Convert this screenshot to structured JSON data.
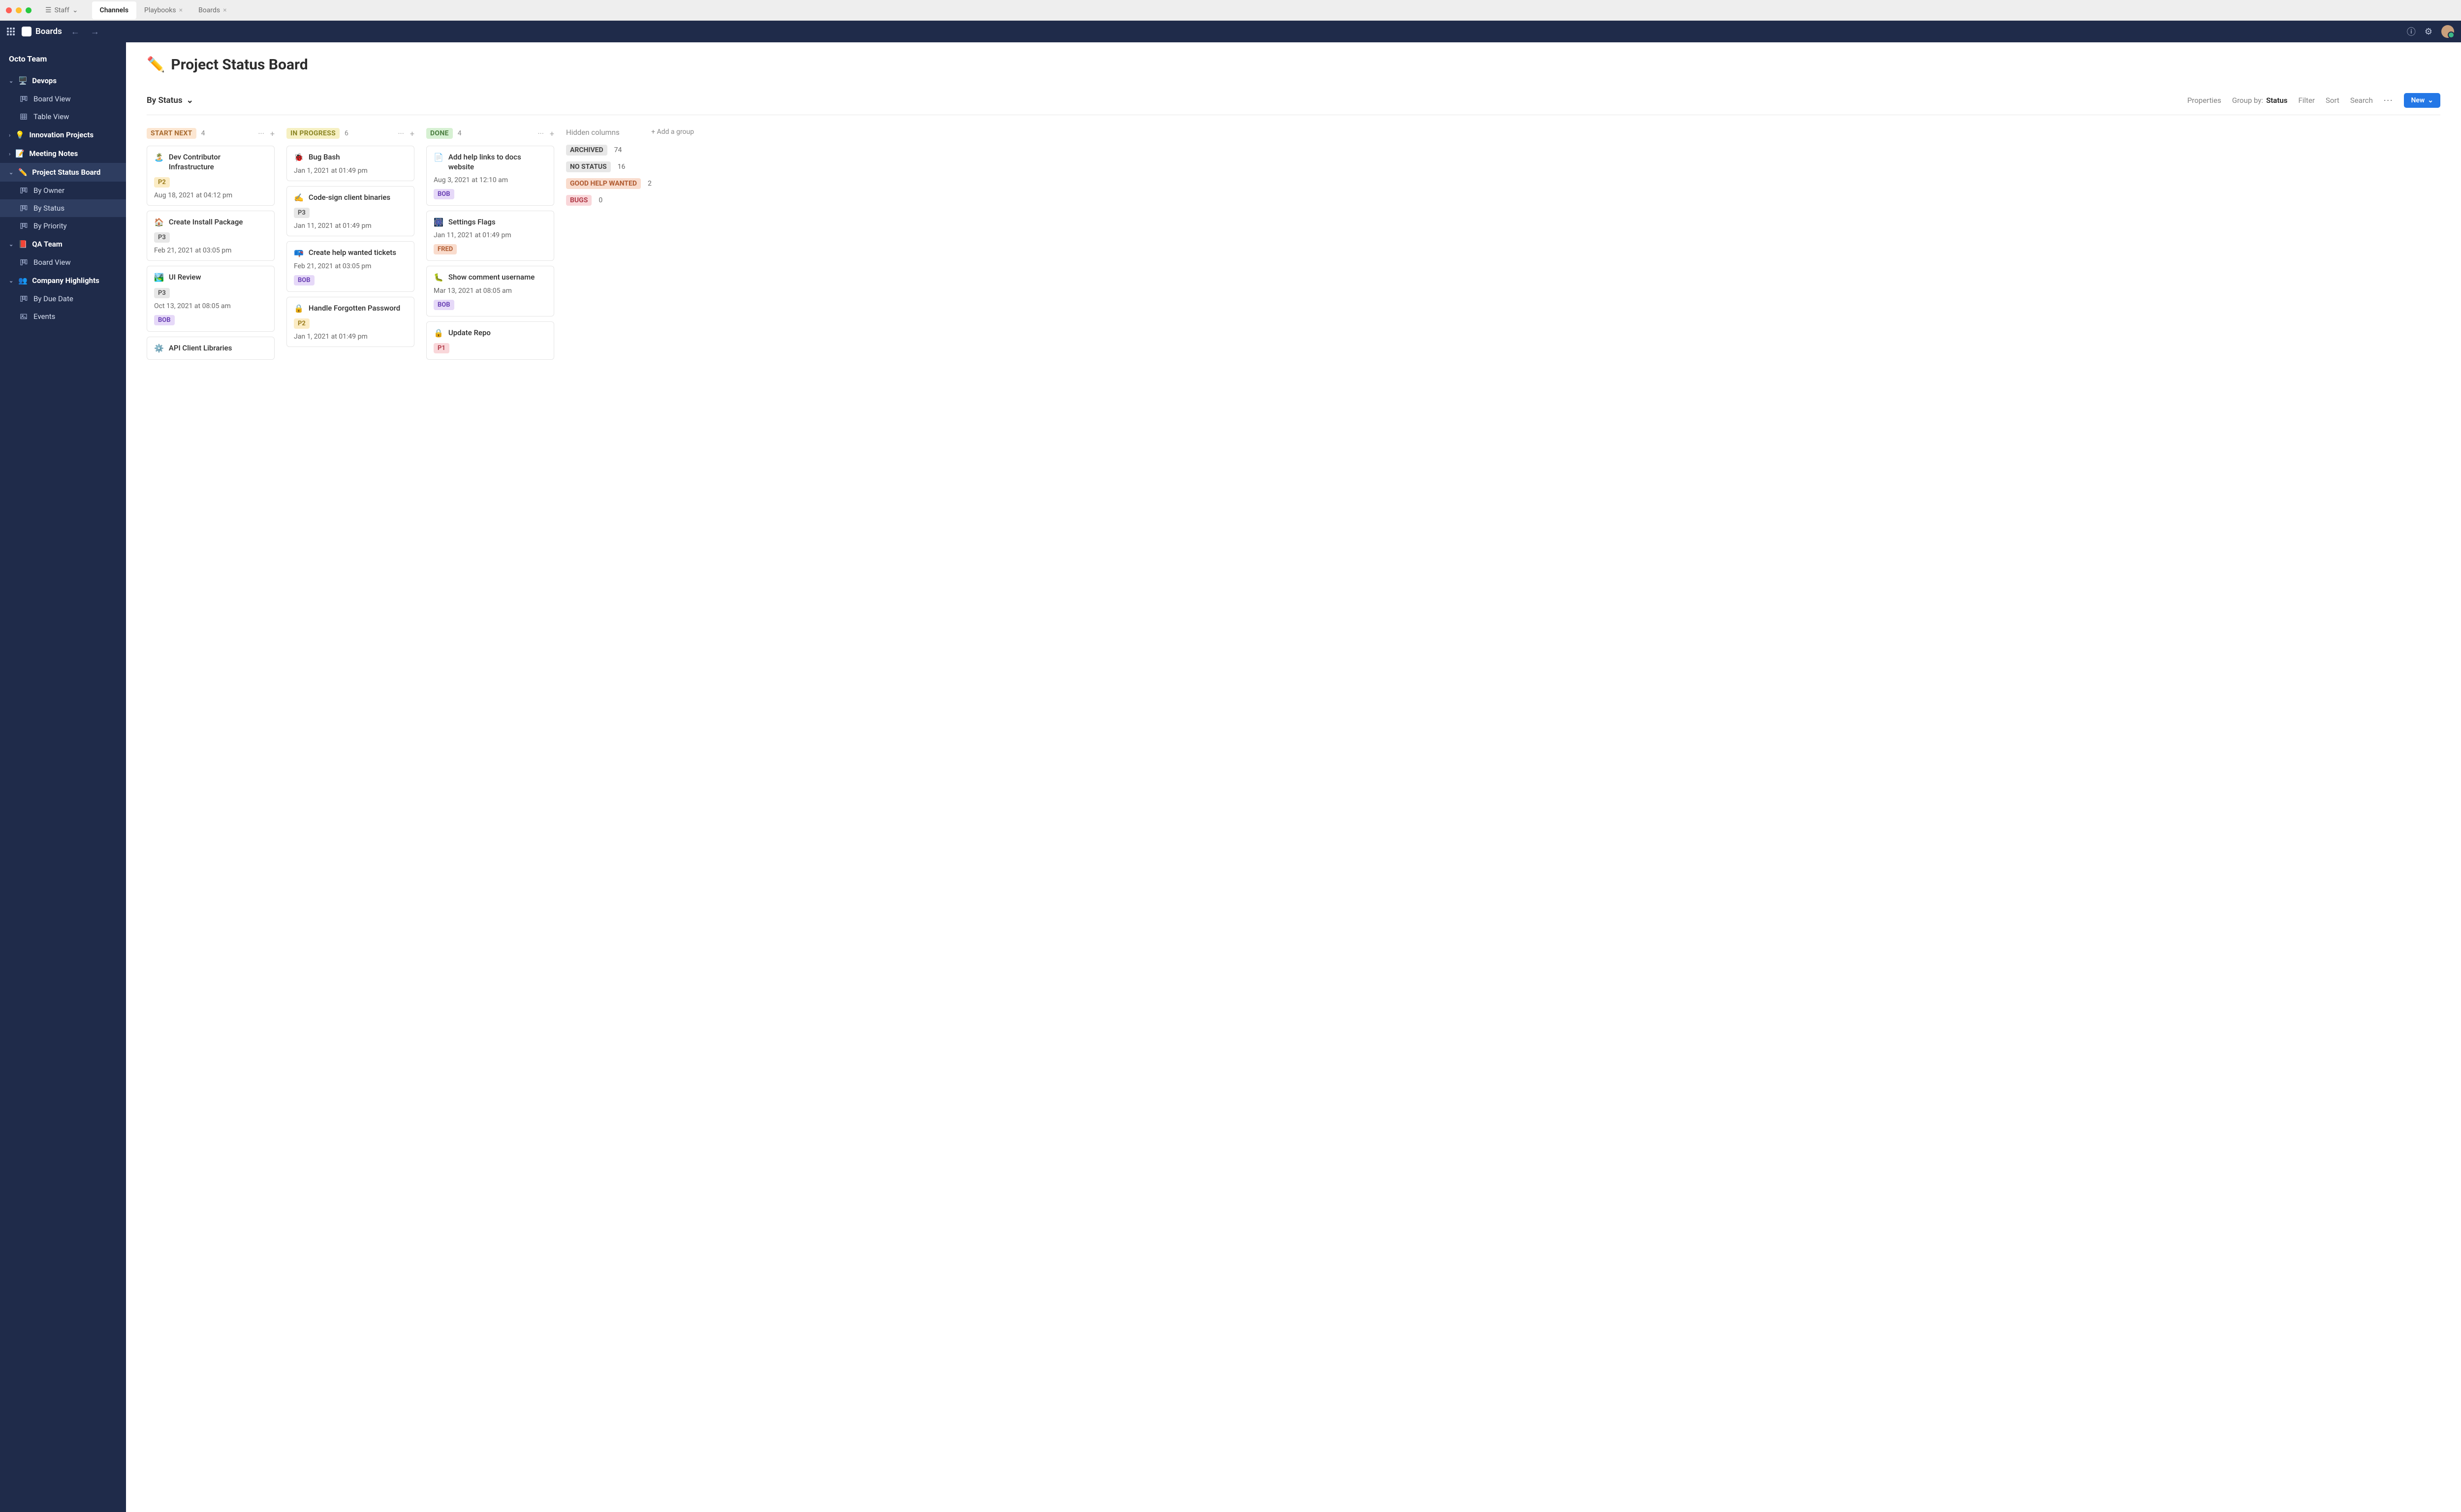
{
  "chrome": {
    "staff_label": "Staff",
    "tabs": [
      {
        "label": "Channels",
        "active": true,
        "closable": false
      },
      {
        "label": "Playbooks",
        "active": false,
        "closable": true
      },
      {
        "label": "Boards",
        "active": false,
        "closable": true
      }
    ]
  },
  "nav": {
    "brand": "Boards"
  },
  "sidebar": {
    "team": "Octo Team",
    "sections": [
      {
        "icon": "🖥️",
        "label": "Devops",
        "expanded": true,
        "active": false,
        "items": [
          {
            "icon": "board",
            "label": "Board View",
            "active": false
          },
          {
            "icon": "table",
            "label": "Table View",
            "active": false
          }
        ]
      },
      {
        "icon": "💡",
        "label": "Innovation Projects",
        "expanded": false,
        "active": false,
        "items": []
      },
      {
        "icon": "📝",
        "label": "Meeting Notes",
        "expanded": false,
        "active": false,
        "items": []
      },
      {
        "icon": "✏️",
        "label": "Project Status Board",
        "expanded": true,
        "active": true,
        "items": [
          {
            "icon": "board",
            "label": "By Owner",
            "active": false
          },
          {
            "icon": "board",
            "label": "By Status",
            "active": true
          },
          {
            "icon": "board",
            "label": "By Priority",
            "active": false
          }
        ]
      },
      {
        "icon": "📕",
        "label": "QA Team",
        "expanded": true,
        "active": false,
        "items": [
          {
            "icon": "board",
            "label": "Board View",
            "active": false
          }
        ]
      },
      {
        "icon": "👥",
        "label": "Company Highlights",
        "expanded": true,
        "active": false,
        "items": [
          {
            "icon": "board",
            "label": "By Due Date",
            "active": false
          },
          {
            "icon": "gallery",
            "label": "Events",
            "active": false
          }
        ]
      }
    ]
  },
  "page": {
    "emoji": "✏️",
    "title": "Project Status Board",
    "view_name": "By Status",
    "actions": {
      "properties": "Properties",
      "group_by_label": "Group by:",
      "group_by_value": "Status",
      "filter": "Filter",
      "sort": "Sort",
      "search": "Search",
      "new": "New"
    }
  },
  "columns": [
    {
      "title": "START NEXT",
      "count": 4,
      "cls": "bg-startnext",
      "cards": [
        {
          "emoji": "🏝️",
          "title": "Dev Contributor Infrastructure",
          "priority": "P2",
          "date": "Aug 18, 2021 at 04:12 pm"
        },
        {
          "emoji": "🏠",
          "title": "Create Install Package",
          "priority": "P3",
          "date": "Feb 21, 2021 at 03:05 pm"
        },
        {
          "emoji": "🏞️",
          "title": "UI Review",
          "priority": "P3",
          "date": "Oct 13, 2021 at 08:05 am",
          "assignee": "BOB"
        },
        {
          "emoji": "⚙️",
          "title": "API Client Libraries"
        }
      ]
    },
    {
      "title": "IN PROGRESS",
      "count": 6,
      "cls": "bg-inprogress",
      "cards": [
        {
          "emoji": "🐞",
          "title": "Bug Bash",
          "date": "Jan 1, 2021 at 01:49 pm"
        },
        {
          "emoji": "✍️",
          "title": "Code-sign client binaries",
          "priority": "P3",
          "date": "Jan 11, 2021 at 01:49 pm"
        },
        {
          "emoji": "📪",
          "title": "Create help wanted tickets",
          "date": "Feb 21, 2021 at 03:05 pm",
          "assignee": "BOB"
        },
        {
          "emoji": "🔒",
          "title": "Handle Forgotten Password",
          "priority": "P2",
          "date": "Jan 1, 2021 at 01:49 pm"
        }
      ]
    },
    {
      "title": "DONE",
      "count": 4,
      "cls": "bg-done",
      "cards": [
        {
          "emoji": "📄",
          "title": "Add help links to docs website",
          "date": "Aug 3, 2021 at 12:10 am",
          "assignee": "BOB"
        },
        {
          "emoji": "🎆",
          "title": "Settings Flags",
          "date": "Jan 11, 2021 at 01:49 pm",
          "assignee": "FRED"
        },
        {
          "emoji": "🐛",
          "title": "Show comment username",
          "date": "Mar 13, 2021 at 08:05 am",
          "assignee": "BOB"
        },
        {
          "emoji": "🔒",
          "title": "Update Repo",
          "priority": "P1"
        }
      ]
    }
  ],
  "hidden": {
    "title": "Hidden columns",
    "add_group": "+  Add a group",
    "rows": [
      {
        "label": "ARCHIVED",
        "count": 74,
        "cls": "hl-archived"
      },
      {
        "label": "NO STATUS",
        "count": 16,
        "cls": "hl-nostatus"
      },
      {
        "label": "GOOD HELP WANTED",
        "count": 2,
        "cls": "hl-good"
      },
      {
        "label": "BUGS",
        "count": 0,
        "cls": "hl-bugs"
      }
    ]
  }
}
